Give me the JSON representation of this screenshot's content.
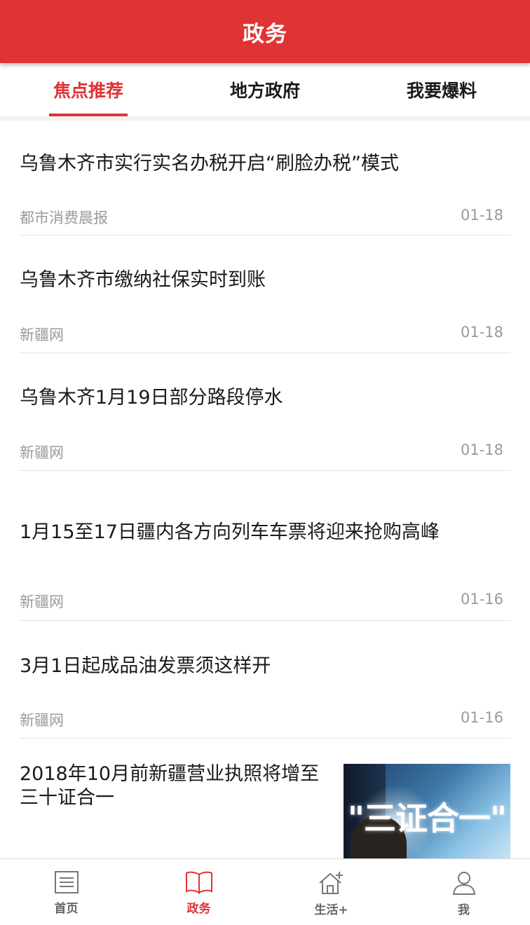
{
  "header": {
    "title": "政务"
  },
  "tabs": [
    {
      "label": "焦点推荐",
      "active": true
    },
    {
      "label": "地方政府",
      "active": false
    },
    {
      "label": "我要爆料",
      "active": false
    }
  ],
  "news": [
    {
      "title": "乌鲁木齐市实行实名办税开启“刷脸办税”模式",
      "source": "都市消费晨报",
      "date": "01-18"
    },
    {
      "title": "乌鲁木齐市缴纳社保实时到账",
      "source": "新疆网",
      "date": "01-18"
    },
    {
      "title": "乌鲁木齐1月19日部分路段停水",
      "source": "新疆网",
      "date": "01-18"
    },
    {
      "title": "1月15至17日疆内各方向列车车票将迎来抢购高峰",
      "source": "新疆网",
      "date": "01-16"
    },
    {
      "title": "3月1日起成品油发票须这样开",
      "source": "新疆网",
      "date": "01-16"
    },
    {
      "title": "2018年10月前新疆营业执照将增至三十证合一",
      "image_text": "\"三证合一\"",
      "image_icon": "hand-pointing-glow"
    }
  ],
  "bottom_nav": [
    {
      "label": "首页",
      "icon": "home-document-icon",
      "active": false
    },
    {
      "label": "政务",
      "icon": "open-book-icon",
      "active": true
    },
    {
      "label": "生活+",
      "icon": "house-plus-icon",
      "active": false
    },
    {
      "label": "我",
      "icon": "person-icon",
      "active": false
    }
  ],
  "colors": {
    "accent": "#e03333",
    "muted_text": "#9a9a9a",
    "divider": "#e4e4e4"
  }
}
